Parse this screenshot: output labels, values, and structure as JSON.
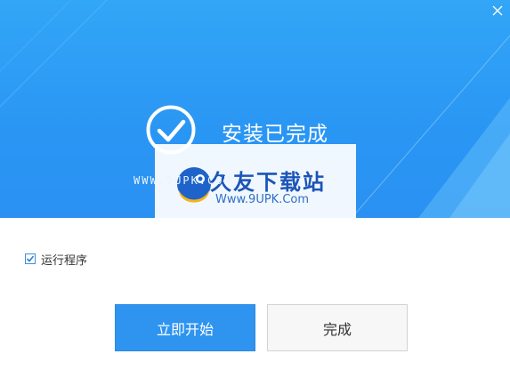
{
  "window": {
    "close_icon": "close-icon"
  },
  "status": {
    "title": "安装已完成",
    "icon": "check-circle-icon"
  },
  "watermark": {
    "title": "久友下载站",
    "url": "Www.9UPK.Com",
    "side_text": "WWW.9UPK.COM"
  },
  "options": {
    "run_program": {
      "label": "运行程序",
      "checked": true
    }
  },
  "buttons": {
    "start": "立即开始",
    "finish": "完成"
  },
  "colors": {
    "accent": "#2e94f0",
    "header": "#2a96f4"
  }
}
